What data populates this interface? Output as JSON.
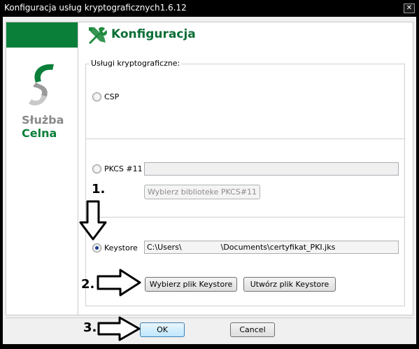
{
  "window": {
    "title": "Konfiguracja usług kryptograficznych1.6.12",
    "close_glyph": "✕"
  },
  "logo": {
    "line1": "Służba",
    "line2": "Celna",
    "colors": {
      "green": "#0a7f3a",
      "gray": "#8a8a8a"
    }
  },
  "header": {
    "title": "Konfiguracja",
    "icon": "tools-icon"
  },
  "group": {
    "legend": "Usługi kryptograficzne:"
  },
  "options": {
    "csp": {
      "label": "CSP",
      "checked": false
    },
    "pkcs": {
      "label": "PKCS #11",
      "checked": false,
      "path_value": "",
      "choose_button": "Wybierz biblioteke PKCS#11"
    },
    "keystore": {
      "label": "Keystore",
      "checked": true,
      "path_value_prefix": "C:\\Users\\",
      "path_value_suffix": "\\Documents\\certyfikat_PKI.jks",
      "choose_button": "Wybierz plik Keystore",
      "create_button": "Utwórz plik Keystore"
    }
  },
  "footer": {
    "ok_label": "OK",
    "cancel_label": "Cancel"
  },
  "annotations": {
    "step1": "1.",
    "step2": "2.",
    "step3": "3."
  }
}
